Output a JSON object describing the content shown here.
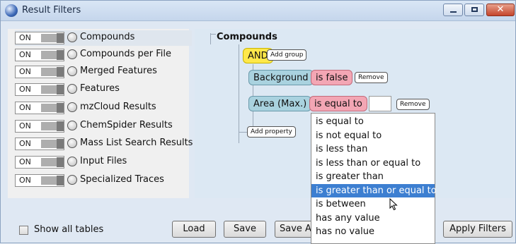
{
  "window": {
    "title": "Result Filters"
  },
  "tables": {
    "toggle_label": "ON",
    "items": [
      "Compounds",
      "Compounds per File",
      "Merged Features",
      "Features",
      "mzCloud Results",
      "ChemSpider Results",
      "Mass List Search Results",
      "Input Files",
      "Specialized Traces"
    ]
  },
  "filter": {
    "title": "Compounds",
    "group_op": "AND",
    "add_group": "Add group",
    "add_property": "Add property",
    "conditions": [
      {
        "property": "Background",
        "operator": "is false",
        "remove": "Remove"
      },
      {
        "property": "Area (Max.)",
        "operator": "is equal to",
        "value": "",
        "remove": "Remove"
      }
    ]
  },
  "operator_dropdown": {
    "options": [
      "is equal to",
      "is not equal to",
      "is less than",
      "is less than or equal to",
      "is greater than",
      "is greater than or equal to",
      "is between",
      "has any value",
      "has no value"
    ],
    "highlighted": "is greater than or equal to"
  },
  "footer": {
    "show_all_tables": "Show all tables",
    "load": "Load",
    "save": "Save",
    "save_as": "Save As...",
    "apply_filters": "Apply Filters"
  }
}
